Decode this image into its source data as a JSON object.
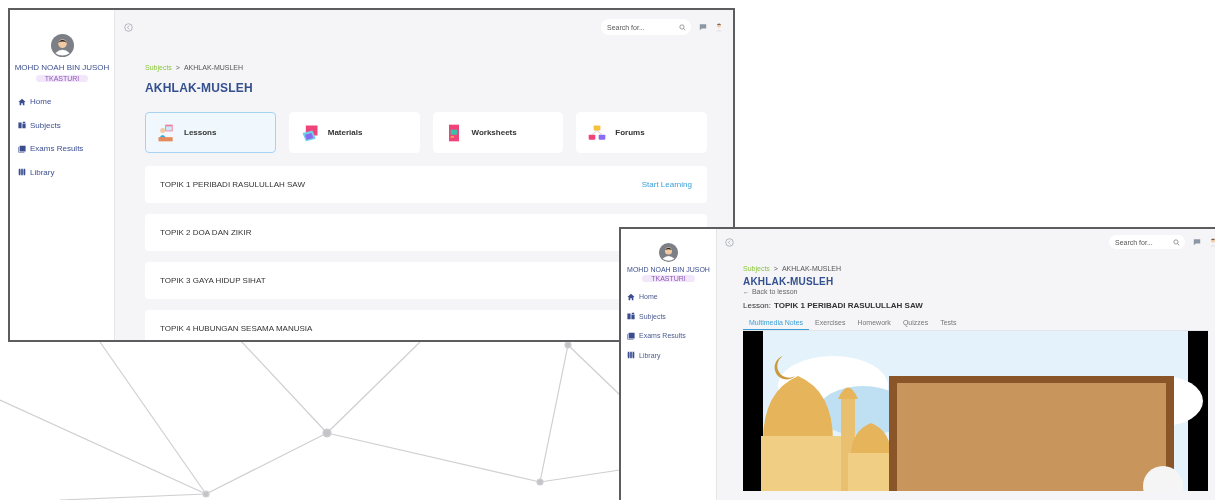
{
  "subject_page": {
    "sidebar": {
      "user_name": "MOHD NOAH BIN JUSOH",
      "badge": "TKASTURI",
      "items": [
        {
          "label": "Home"
        },
        {
          "label": "Subjects"
        },
        {
          "label": "Exams Results"
        },
        {
          "label": "Library"
        }
      ]
    },
    "search": {
      "placeholder": "Search for..."
    },
    "breadcrumb": [
      "Subjects",
      "AKHLAK-MUSLEH"
    ],
    "breadcrumb_separator": ">",
    "title": "AKHLAK-MUSLEH",
    "categories": [
      {
        "label": "Lessons",
        "selected": true
      },
      {
        "label": "Materials",
        "selected": false
      },
      {
        "label": "Worksheets",
        "selected": false
      },
      {
        "label": "Forums",
        "selected": false
      }
    ],
    "topics": [
      {
        "title": "TOPIK 1 PERIBADI RASULULLAH SAW",
        "action": "Start Learning"
      },
      {
        "title": "TOPIK 2 DOA DAN ZIKIR"
      },
      {
        "title": "TOPIK 3 GAYA HIDUP SIHAT"
      },
      {
        "title": "TOPIK 4 HUBUNGAN SESAMA MANUSIA"
      }
    ]
  },
  "lesson_page": {
    "sidebar": {
      "user_name": "MOHD NOAH BIN JUSOH",
      "badge": "TKASTURI",
      "items": [
        {
          "label": "Home"
        },
        {
          "label": "Subjects"
        },
        {
          "label": "Exams Results"
        },
        {
          "label": "Library"
        }
      ]
    },
    "search": {
      "placeholder": "Search for..."
    },
    "breadcrumb": [
      "Subjects",
      "AKHLAK-MUSLEH"
    ],
    "breadcrumb_separator": ">",
    "title": "AKHLAK-MUSLEH",
    "back_link": "← Back to lesson",
    "lesson_label": "Lesson:",
    "lesson_title": "TOPIK 1 PERIBADI RASULULLAH SAW",
    "tabs": [
      {
        "label": "Multimedia Notes",
        "selected": true
      },
      {
        "label": "Exercises",
        "selected": false
      },
      {
        "label": "Homework",
        "selected": false
      },
      {
        "label": "Quizzes",
        "selected": false
      },
      {
        "label": "Tests",
        "selected": false
      }
    ]
  }
}
